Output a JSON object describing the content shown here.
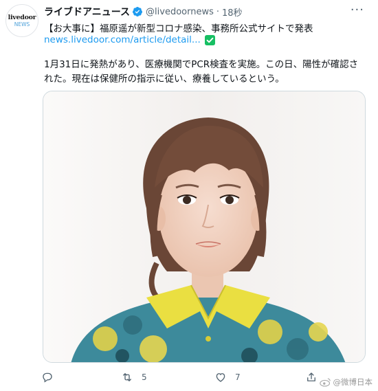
{
  "tweet": {
    "avatar_line1": "livedoor",
    "avatar_line2": "NEWS",
    "display_name": "ライブドアニュース",
    "handle": "@livedoornews",
    "separator": "·",
    "time": "18秒",
    "headline": "【お大事に】福原遥が新型コロナ感染、事務所公式サイトで発表",
    "link": "news.livedoor.com/article/detail...",
    "body": "1月31日に発熱があり、医療機関でPCR検査を実施。この日、陽性が確認された。現在は保健所の指示に従い、療養しているという。"
  },
  "actions": {
    "retweets": "5",
    "likes": "7"
  },
  "watermark": {
    "text": "@微博日本"
  },
  "icons": {
    "verified": "verified-badge-icon",
    "check": "green-check-icon",
    "more": "more-icon",
    "reply": "reply-icon",
    "retweet": "retweet-icon",
    "like": "heart-icon",
    "share": "share-icon"
  },
  "colors": {
    "link": "#1d9bf0",
    "verified": "#1d9bf0",
    "check": "#17bf63",
    "secondary_text": "#536471"
  }
}
